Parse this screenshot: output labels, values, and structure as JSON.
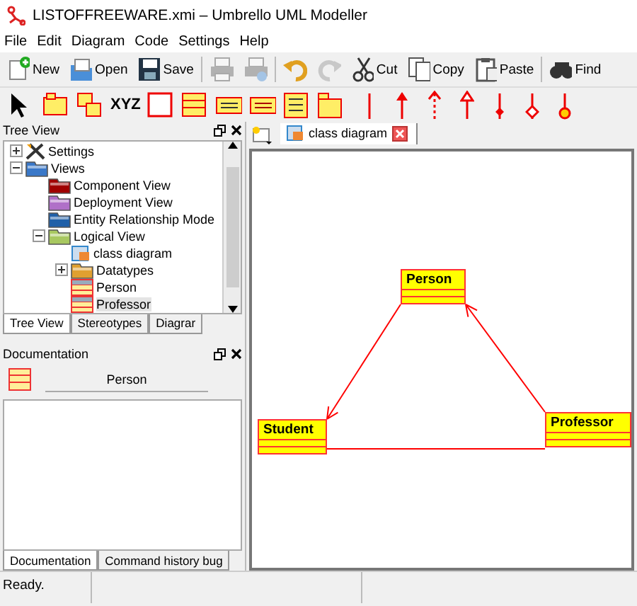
{
  "window": {
    "title": "LISTOFFREEWARE.xmi – Umbrello UML Modeller"
  },
  "menu": [
    "File",
    "Edit",
    "Diagram",
    "Code",
    "Settings",
    "Help"
  ],
  "toolbar": [
    {
      "kind": "new",
      "label": "New",
      "disabled": false
    },
    {
      "kind": "open",
      "label": "Open",
      "disabled": false
    },
    {
      "kind": "save",
      "label": "Save",
      "disabled": false
    },
    {
      "kind": "print",
      "disabled": true
    },
    {
      "kind": "preview",
      "disabled": true
    },
    {
      "kind": "undo",
      "disabled": false
    },
    {
      "kind": "redo",
      "disabled": true
    },
    {
      "kind": "cut",
      "label": "Cut",
      "disabled": false
    },
    {
      "kind": "copy",
      "label": "Copy",
      "disabled": false
    },
    {
      "kind": "paste",
      "label": "Paste",
      "disabled": false
    },
    {
      "kind": "find",
      "label": "Find",
      "disabled": false
    }
  ],
  "tools": [
    {
      "kind": "pointer"
    },
    {
      "kind": "class-tag"
    },
    {
      "kind": "note"
    },
    {
      "kind": "text",
      "label": "XYZ"
    },
    {
      "kind": "box"
    },
    {
      "kind": "class"
    },
    {
      "kind": "interface"
    },
    {
      "kind": "datatype"
    },
    {
      "kind": "enum"
    },
    {
      "kind": "package"
    },
    {
      "kind": "line"
    },
    {
      "kind": "arrow"
    },
    {
      "kind": "dashed"
    },
    {
      "kind": "hollow"
    },
    {
      "kind": "diamond"
    },
    {
      "kind": "open-diamond"
    },
    {
      "kind": "circle"
    }
  ],
  "tree_panel": {
    "title": "Tree View",
    "items": [
      {
        "label": "Settings",
        "kind": "settings",
        "expanded": false,
        "selected": false
      },
      {
        "label": "Views",
        "kind": "folder",
        "color": "#3a78c8",
        "expanded": true,
        "selected": false,
        "children": [
          {
            "label": "Component View",
            "kind": "folder",
            "color": "#a00000",
            "selected": false
          },
          {
            "label": "Deployment View",
            "kind": "folder",
            "color": "#b070c8",
            "selected": false
          },
          {
            "label": "Entity Relationship Mode",
            "kind": "folder",
            "color": "#2060a8",
            "selected": false
          },
          {
            "label": "Logical View",
            "kind": "folder",
            "color": "#a8c860",
            "expanded": true,
            "selected": false,
            "children": [
              {
                "label": "class diagram",
                "kind": "diagram",
                "selected": false
              },
              {
                "label": "Datatypes",
                "kind": "folder",
                "color": "#e0a030",
                "expanded": false,
                "selected": false
              },
              {
                "label": "Person",
                "kind": "class",
                "selected": false
              },
              {
                "label": "Professor",
                "kind": "class",
                "selected": true
              }
            ]
          }
        ]
      }
    ],
    "tabs": [
      {
        "label": "Tree View",
        "selected": true
      },
      {
        "label": "Stereotypes",
        "selected": false
      },
      {
        "label": "Diagrar",
        "selected": false
      }
    ]
  },
  "documentation_panel": {
    "title": "Documentation",
    "name": "Person",
    "tabs": [
      {
        "label": "Documentation",
        "selected": true
      },
      {
        "label": "Command history  bug",
        "selected": false
      }
    ]
  },
  "diagram_tabs": [
    {
      "label": "class diagram",
      "selected": true
    }
  ],
  "diagram": {
    "classes": [
      {
        "name": "Person"
      },
      {
        "name": "Student"
      },
      {
        "name": "Professor"
      }
    ],
    "relations": [
      {
        "kind": "directed"
      },
      {
        "kind": "directed"
      },
      {
        "kind": "association"
      }
    ]
  },
  "status_bar": {
    "text": "Ready."
  }
}
